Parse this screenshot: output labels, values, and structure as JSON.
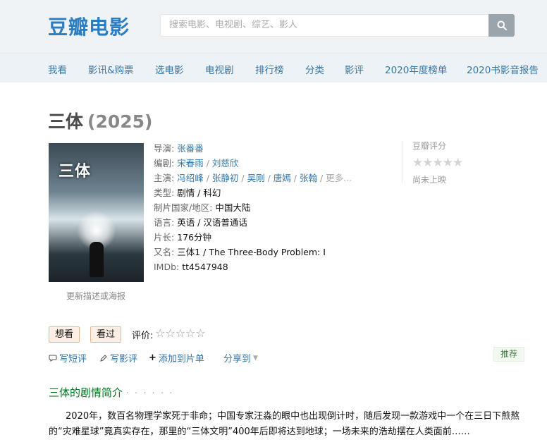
{
  "header": {
    "logo": "豆瓣电影",
    "search_placeholder": "搜索电影、电视剧、综艺、影人",
    "search_icon": "search-icon"
  },
  "nav": {
    "items": [
      "我看",
      "影讯&购票",
      "选电影",
      "电视剧",
      "排行榜",
      "分类",
      "影评",
      "2020年度榜单",
      "2020书影音报告"
    ]
  },
  "movie": {
    "title": "三体",
    "year": "(2025)",
    "poster_title": "三体",
    "poster_update": "更新描述或海报",
    "director_label": "导演:",
    "director": "张番番",
    "writer_label": "编剧:",
    "writers": [
      "宋春雨",
      "刘慈欣"
    ],
    "cast_label": "主演:",
    "cast": [
      "冯绍峰",
      "张静初",
      "吴刚",
      "唐嫣",
      "张翰"
    ],
    "cast_more": "更多...",
    "genre_label": "类型:",
    "genre": "剧情 / 科幻",
    "country_label": "制片国家/地区:",
    "country": "中国大陆",
    "language_label": "语言:",
    "language": "英语 / 汉语普通话",
    "runtime_label": "片长:",
    "runtime": "176分钟",
    "aka_label": "又名:",
    "aka": "三体1 / The Three-Body Problem: I",
    "imdb_label": "IMDb:",
    "imdb": "tt4547948"
  },
  "rating": {
    "title": "豆瓣评分",
    "status": "尚未上映"
  },
  "actions": {
    "want": "想看",
    "seen": "看过",
    "rate_label": "评价:",
    "short_review": "写短评",
    "review": "写影评",
    "add_list": "添加到片单",
    "share": "分享到",
    "recommend": "推荐"
  },
  "summary": {
    "title": "三体的剧情简介",
    "dots": "· · · · · ·",
    "text": "2020年，数百名物理学家死于非命；中国专家汪淼的眼中也出现倒计时，随后发现一款游戏中一个在三日下煎熬的“灾难星球”竟真实存在，那里的“三体文明”400年后即将达到地球；一场未来的浩劫摆在人类面前……"
  },
  "colors": {
    "link": "#3377aa",
    "logo": "#2a7dc1",
    "section_title": "#007722",
    "button_bg": "#fdefe5"
  }
}
